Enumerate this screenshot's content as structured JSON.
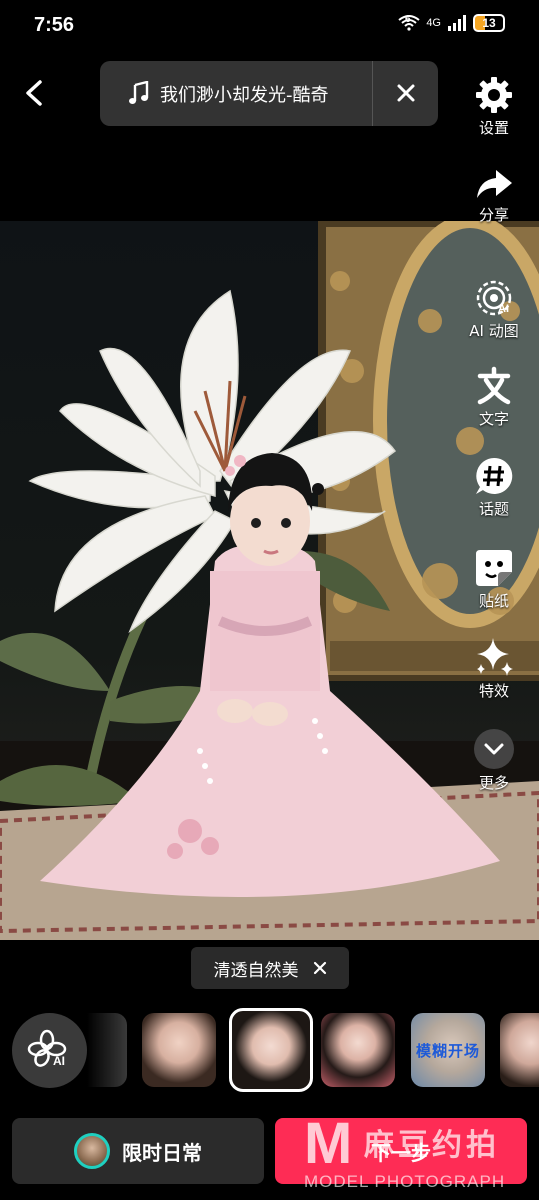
{
  "status_bar": {
    "time": "7:56",
    "signal_text": "4G",
    "wifi_text": "6",
    "battery": "13"
  },
  "music": {
    "title": "我们渺小却发光-酷奇"
  },
  "tools": [
    {
      "id": "settings",
      "label": "设置",
      "icon": "gear-icon"
    },
    {
      "id": "share",
      "label": "分享",
      "icon": "share-icon"
    },
    {
      "id": "ai",
      "label": "AI 动图",
      "icon": "ai-motion-icon"
    },
    {
      "id": "text",
      "label": "文字",
      "icon": "text-icon"
    },
    {
      "id": "topic",
      "label": "话题",
      "icon": "hashtag-icon"
    },
    {
      "id": "sticker",
      "label": "贴纸",
      "icon": "sticker-icon"
    },
    {
      "id": "effects",
      "label": "特效",
      "icon": "sparkle-icon"
    },
    {
      "id": "more",
      "label": "更多",
      "icon": "chevron-down-icon"
    }
  ],
  "effect_chip": {
    "label": "清透自然美"
  },
  "filters": {
    "ai_label": "AI",
    "thumbs": [
      {
        "name": "filter-1",
        "text": ""
      },
      {
        "name": "filter-2",
        "text": "",
        "selected": true
      },
      {
        "name": "filter-3",
        "text": ""
      },
      {
        "name": "filter-4",
        "text": "模糊开场"
      },
      {
        "name": "filter-5",
        "text": ""
      }
    ]
  },
  "bottom": {
    "left_label": "限时日常",
    "next_label": "下一步"
  },
  "watermark": {
    "brand_cn": "麻豆约拍",
    "brand_en": "MODEL PHOTOGRAPH",
    "letter": "M"
  }
}
